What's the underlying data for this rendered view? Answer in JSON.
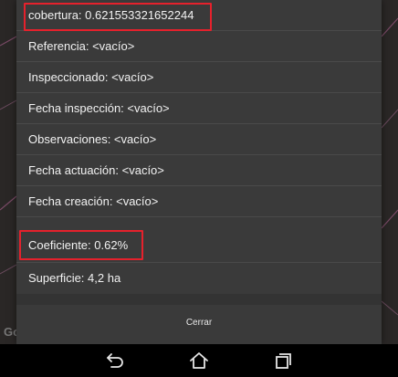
{
  "map": {
    "logo": "Go"
  },
  "dialog": {
    "rows": [
      {
        "label": "cobertura: 0.621553321652244"
      },
      {
        "label": "Referencia: <vacío>"
      },
      {
        "label": "Inspeccionado: <vacío>"
      },
      {
        "label": "Fecha inspección: <vacío>"
      },
      {
        "label": "Observaciones: <vacío>"
      },
      {
        "label": "Fecha actuación: <vacío>"
      },
      {
        "label": "Fecha creación: <vacío>"
      },
      {
        "label": "Coeficiente: 0.62%"
      },
      {
        "label": "Superficie: 4,2 ha"
      }
    ],
    "close_label": "Cerrar"
  },
  "nav": {
    "icons": [
      "back-icon",
      "home-icon",
      "recents-icon"
    ]
  },
  "colors": {
    "highlight": "#e5212c",
    "dialog_bg": "#3a3a3a",
    "text": "#f2f2f2"
  }
}
